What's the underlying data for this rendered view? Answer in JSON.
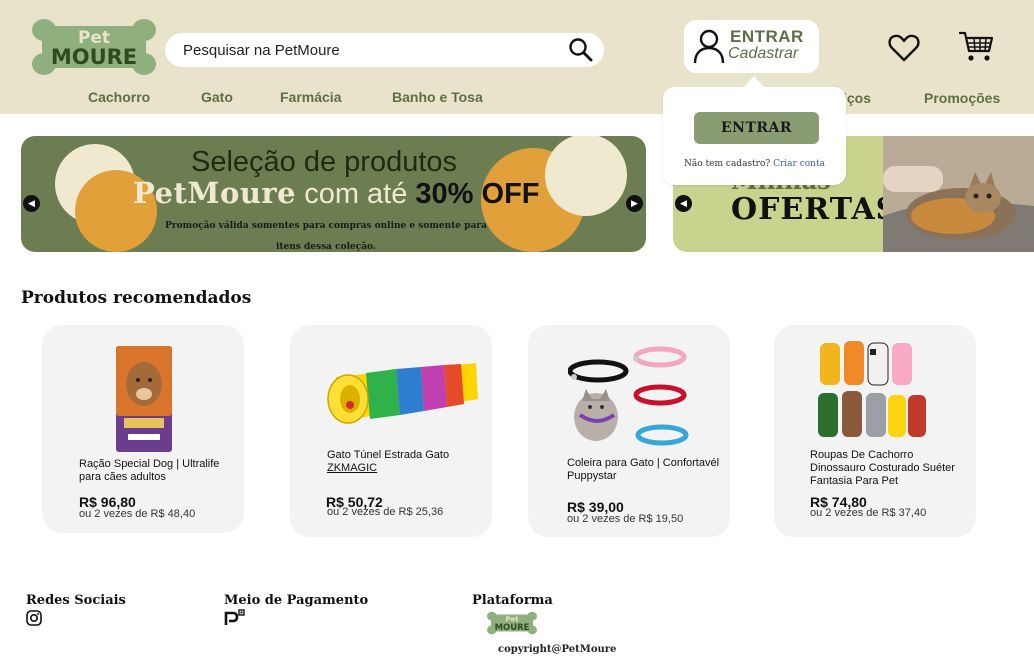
{
  "header": {
    "search_placeholder": "Pesquisar na PetMoure",
    "login_title": "ENTRAR",
    "login_subtitle": "Cadastrar",
    "logo_top": "Pet",
    "logo_bottom": "MOURE"
  },
  "nav": {
    "items": [
      "Cachorro",
      "Gato",
      "Farmácia",
      "Banho e Tosa",
      "Serviços",
      "Promoções"
    ],
    "servicos_visible": "iços"
  },
  "login_dropdown": {
    "button_label": "ENTRAR",
    "no_account_text": "Não tem cadastro?",
    "create_account_link": "Criar conta"
  },
  "banner_main": {
    "line1": "Seleção de produtos",
    "brand": "PetMoure",
    "mid_text": " com até ",
    "discount": "30% OFF",
    "note": "Promoção válida somentes para compras online e somente para itens dessa coleção."
  },
  "banner_offers": {
    "line1": "Minhas",
    "line2": "OFERTAS"
  },
  "recommended": {
    "title": "Produtos recomendados",
    "products": [
      {
        "name": "Ração Special Dog | Ultralife para cães adultos",
        "price": "R$ 96,80",
        "installments": "ou 2 vezes de R$ 48,40"
      },
      {
        "name": "Gato Túnel Estrada Gato ZKMAGIC",
        "price": "R$ 50,72",
        "installments": "ou 2 vezes de R$ 25,36"
      },
      {
        "name": "Coleira para Gato | Confortavél Puppystar",
        "price": "R$ 39,00",
        "installments": "ou 2 vezes de R$ 19,50"
      },
      {
        "name": "Roupas De Cachorro Dinossauro Costurado Suéter Fantasia Para Pet",
        "price": "R$ 74,80",
        "installments": "ou 2 vezes de R$ 37,40"
      }
    ]
  },
  "footer": {
    "social_title": "Redes Sociais",
    "payment_title": "Meio de Pagamento",
    "platform_title": "Plataforma",
    "copyright": "copyright@PetMoure"
  },
  "colors": {
    "header_bg": "#e8e3ca",
    "accent_green": "#5e6f45",
    "button_green": "#8a9c72",
    "banner_green": "#6d7d52",
    "orange": "#e1a03a"
  },
  "icons": [
    "search-icon",
    "user-icon",
    "heart-icon",
    "cart-icon",
    "arrow-left-icon",
    "arrow-right-icon",
    "instagram-icon",
    "pix-icon"
  ]
}
